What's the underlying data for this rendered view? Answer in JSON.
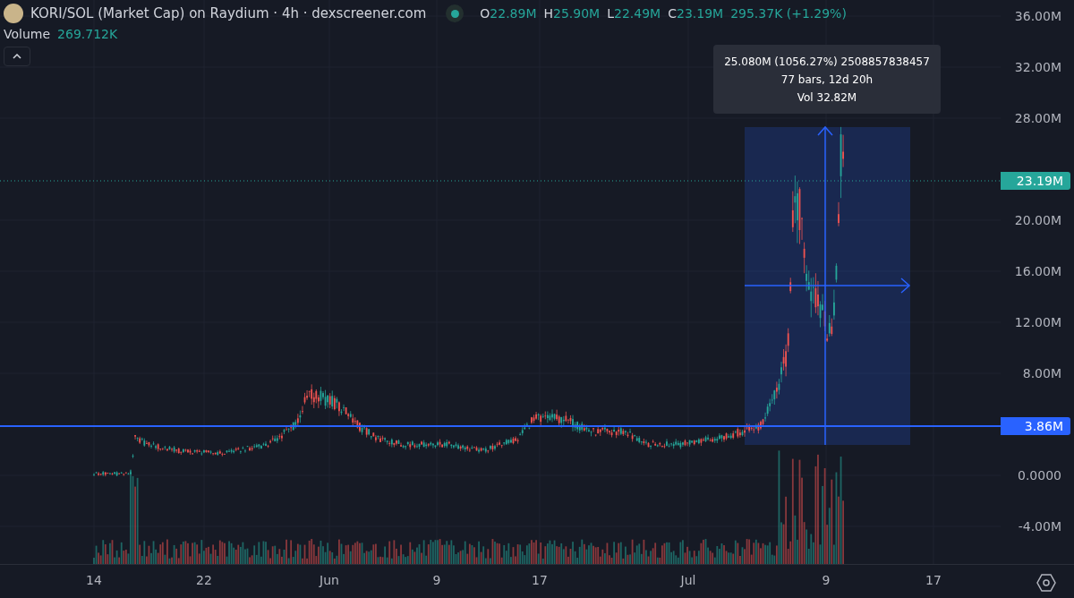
{
  "header": {
    "title": "KORI/SOL (Market Cap) on Raydium · 4h · dexscreener.com",
    "live": true,
    "ohlc": [
      {
        "label": "O",
        "value": "22.89M"
      },
      {
        "label": "H",
        "value": "25.90M"
      },
      {
        "label": "L",
        "value": "22.49M"
      },
      {
        "label": "C",
        "value": "23.19M"
      }
    ],
    "change": "295.37K (+1.29%)"
  },
  "volume": {
    "label": "Volume",
    "value": "269.712K"
  },
  "tooltip": {
    "lines": [
      "25.080M (1056.27%) 2508857838457",
      "77 bars, 12d 20h",
      "Vol 32.82M"
    ]
  },
  "price_axis": {
    "labels": [
      "36.00M",
      "32.00M",
      "28.00M",
      "20.00M",
      "16.00M",
      "12.00M",
      "8.00M",
      "0.0000",
      "-4.00M"
    ],
    "markers": [
      {
        "text": "23.19M",
        "kind": "last"
      },
      {
        "text": "3.86M",
        "kind": "line"
      }
    ]
  },
  "time_axis": {
    "labels": [
      "14",
      "22",
      "Jun",
      "9",
      "17",
      "Jul",
      "9",
      "17"
    ]
  }
}
